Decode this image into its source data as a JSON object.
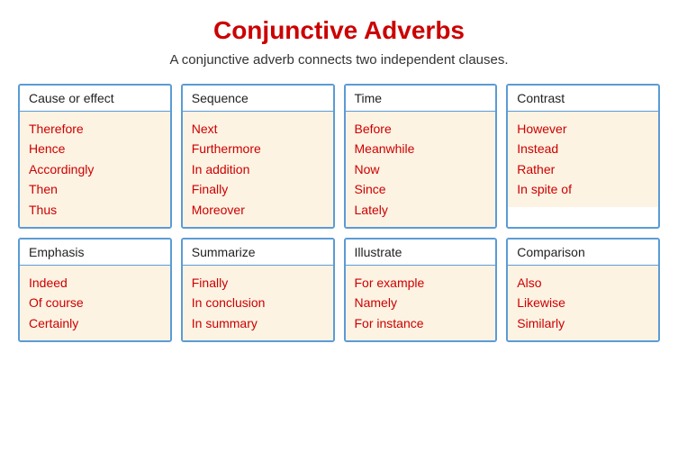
{
  "title": "Conjunctive Adverbs",
  "subtitle": "A conjunctive adverb connects two independent clauses.",
  "cards": [
    {
      "header": "Cause or effect",
      "items": [
        "Therefore",
        "Hence",
        "Accordingly",
        "Then",
        "Thus"
      ]
    },
    {
      "header": "Sequence",
      "items": [
        "Next",
        "Furthermore",
        "In addition",
        "Finally",
        "Moreover"
      ]
    },
    {
      "header": "Time",
      "items": [
        "Before",
        "Meanwhile",
        "Now",
        "Since",
        "Lately"
      ]
    },
    {
      "header": "Contrast",
      "items": [
        "However",
        "Instead",
        "Rather",
        "In spite of"
      ]
    },
    {
      "header": "Emphasis",
      "items": [
        "Indeed",
        "Of course",
        "Certainly"
      ]
    },
    {
      "header": "Summarize",
      "items": [
        "Finally",
        "In conclusion",
        "In summary"
      ]
    },
    {
      "header": "Illustrate",
      "items": [
        "For example",
        "Namely",
        "For instance"
      ]
    },
    {
      "header": "Comparison",
      "items": [
        "Also",
        "Likewise",
        "Similarly"
      ]
    }
  ]
}
